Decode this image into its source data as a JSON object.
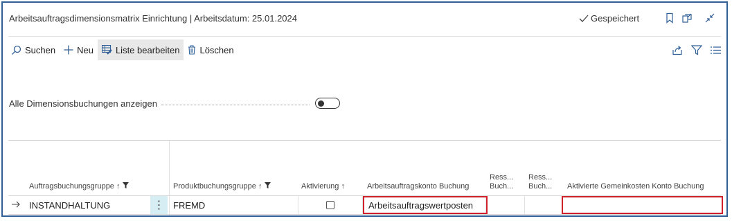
{
  "header": {
    "title": "Arbeitsauftragsdimensionsmatrix Einrichtung | Arbeitsdatum: 25.01.2024",
    "saved_label": "Gespeichert",
    "icons": [
      "bookmark-icon",
      "open-new-window-icon",
      "collapse-icon"
    ]
  },
  "actions": {
    "search": "Suchen",
    "new": "Neu",
    "edit_list": "Liste bearbeiten",
    "delete": "Löschen",
    "right_icons": [
      "share-icon",
      "filter-icon",
      "list-view-icon"
    ]
  },
  "toggle": {
    "label": "Alle Dimensionsbuchungen anzeigen",
    "on": false
  },
  "table": {
    "columns": [
      {
        "label": "Auftragsbuchungsgruppe",
        "sort": "↑",
        "filtered": true
      },
      {
        "label": "Produktbuchungsgruppe",
        "sort": "↑",
        "filtered": true
      },
      {
        "label": "Aktivierung",
        "sort": "↑",
        "filtered": false
      },
      {
        "label": "Arbeitsauftragskonto Buchung",
        "sort": "",
        "filtered": false
      },
      {
        "label": "Ress... Buch...",
        "sort": "",
        "filtered": false
      },
      {
        "label": "Ress... Buch...",
        "sort": "",
        "filtered": false
      },
      {
        "label": "Aktivierte Gemeinkosten Konto Buchung",
        "sort": "",
        "filtered": false
      }
    ],
    "col5_line1": "Ress...",
    "col5_line2": "Buch...",
    "col6_line1": "Ress...",
    "col6_line2": "Buch...",
    "rows": [
      {
        "auftragsbuchungsgruppe": "INSTANDHALTUNG",
        "produktbuchungsgruppe": "FREMD",
        "aktivierung": false,
        "arbeitsauftragskonto_buchung": "Arbeitsauftragswertposten",
        "ress_buch_1": "",
        "ress_buch_2": "",
        "aktivierte_gemeinkosten_konto_buchung": ""
      }
    ]
  },
  "colors": {
    "frame_border": "#2f5f96",
    "highlight": "#d0202a",
    "context_cell": "#d6eef3",
    "active_action": "#e8e8e8"
  }
}
